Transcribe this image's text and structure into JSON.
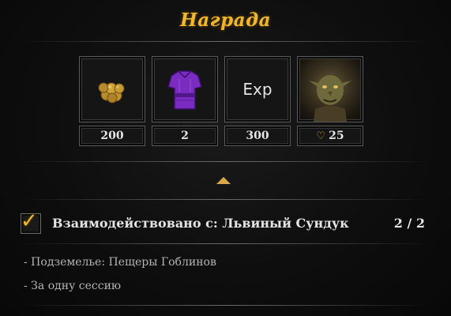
{
  "panel": {
    "title": "Награда"
  },
  "rewards": [
    {
      "icon": "gold-coins-icon",
      "count": "200"
    },
    {
      "icon": "purple-armor-icon",
      "count": "2"
    },
    {
      "icon": "exp-icon",
      "label": "Exp",
      "count": "300"
    },
    {
      "icon": "goblin-portrait-icon",
      "count": "25"
    }
  ],
  "objective": {
    "text": "Взаимодействовано с: Львиный Сундук",
    "progress": "2 / 2",
    "completed": true
  },
  "conditions": [
    "- Подземелье: Пещеры Гоблинов",
    "- За одну сессию"
  ],
  "colors": {
    "title": "#f0b72a",
    "accent": "#d9a64a",
    "background": "#0d0d0d"
  }
}
